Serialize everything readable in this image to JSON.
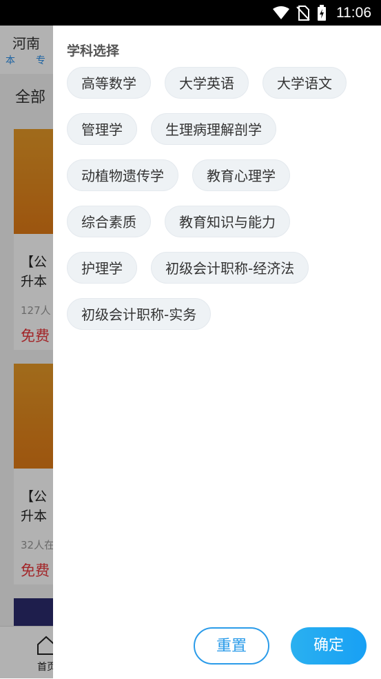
{
  "status_bar": {
    "time": "11:06"
  },
  "background": {
    "city": "河南",
    "tags": [
      "本",
      "专"
    ],
    "filter_label": "全部",
    "cards": [
      {
        "title_line1": "【公",
        "title_line2": "升本",
        "students": "127人",
        "price": "免费"
      },
      {
        "title_line1": "【公",
        "title_line2": "升本",
        "students": "32人在",
        "price": "免费"
      }
    ],
    "tabbar": {
      "home_label": "首页"
    }
  },
  "drawer": {
    "title": "学科选择",
    "subjects": [
      [
        "高等数学",
        "大学英语",
        "大学语文"
      ],
      [
        "管理学",
        "生理病理解剖学"
      ],
      [
        "动植物遗传学",
        "教育心理学"
      ],
      [
        "综合素质",
        "教育知识与能力"
      ],
      [
        "护理学",
        "初级会计职称-经济法"
      ],
      [
        "初级会计职称-实务"
      ]
    ],
    "reset_label": "重置",
    "confirm_label": "确定"
  },
  "colors": {
    "accent": "#2a9be9",
    "price_red": "#e8363a",
    "chip_bg": "#eef2f5"
  }
}
